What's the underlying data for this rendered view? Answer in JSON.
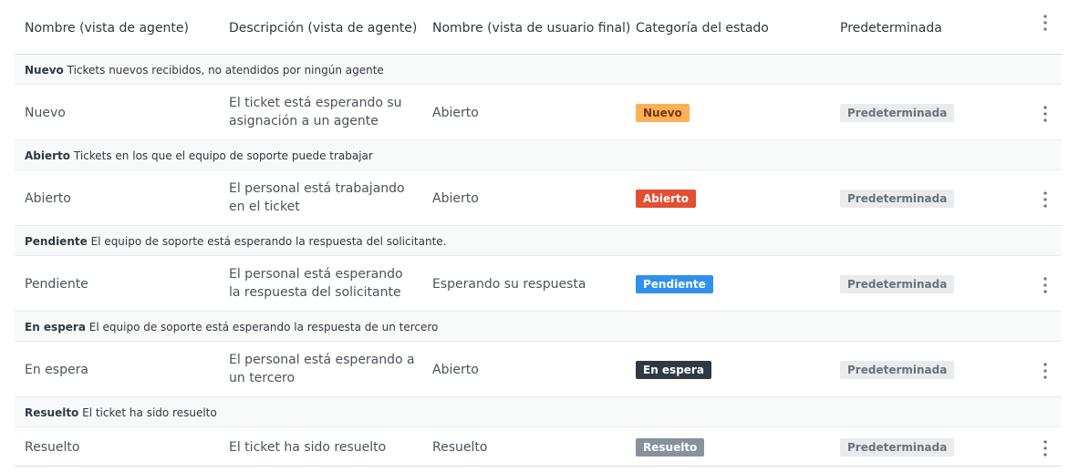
{
  "colors": {
    "nuevo": "#ffb057",
    "abierto": "#e34f32",
    "pendiente": "#3091ec",
    "en_espera": "#2f3941",
    "resuelto": "#87929d",
    "default_badge_bg": "#e9ebed"
  },
  "header": {
    "name_agent": "Nombre (vista de agente)",
    "desc_agent": "Descripción (vista de agente)",
    "name_end_user": "Nombre (vista de usuario final)",
    "category": "Categoría del estado",
    "default": "Predeterminada",
    "menu_icon": "more-vertical-icon"
  },
  "groups": [
    {
      "name": "Nuevo",
      "description": "Tickets nuevos recibidos, no atendidos por ningún agente",
      "row": {
        "name_agent": "Nuevo",
        "desc_agent": "El ticket está esperando su asignación a un agente",
        "name_end_user": "Abierto",
        "category": "Nuevo",
        "default_label": "Predeterminada"
      }
    },
    {
      "name": "Abierto",
      "description": "Tickets en los que el equipo de soporte puede trabajar",
      "row": {
        "name_agent": "Abierto",
        "desc_agent": "El personal está trabajando en el ticket",
        "name_end_user": "Abierto",
        "category": "Abierto",
        "default_label": "Predeterminada"
      }
    },
    {
      "name": "Pendiente",
      "description": "El equipo de soporte está esperando la respuesta del solicitante.",
      "row": {
        "name_agent": "Pendiente",
        "desc_agent": "El personal está esperando la respuesta del solicitante",
        "name_end_user": "Esperando su respuesta",
        "category": "Pendiente",
        "default_label": "Predeterminada"
      }
    },
    {
      "name": "En espera",
      "description": "El equipo de soporte está esperando la respuesta de un tercero",
      "row": {
        "name_agent": "En espera",
        "desc_agent": "El personal está esperando a un tercero",
        "name_end_user": "Abierto",
        "category": "En espera",
        "default_label": "Predeterminada"
      }
    },
    {
      "name": "Resuelto",
      "description": "El ticket ha sido resuelto",
      "row": {
        "name_agent": "Resuelto",
        "desc_agent": "El ticket ha sido resuelto",
        "name_end_user": "Resuelto",
        "category": "Resuelto",
        "default_label": "Predeterminada"
      }
    }
  ]
}
